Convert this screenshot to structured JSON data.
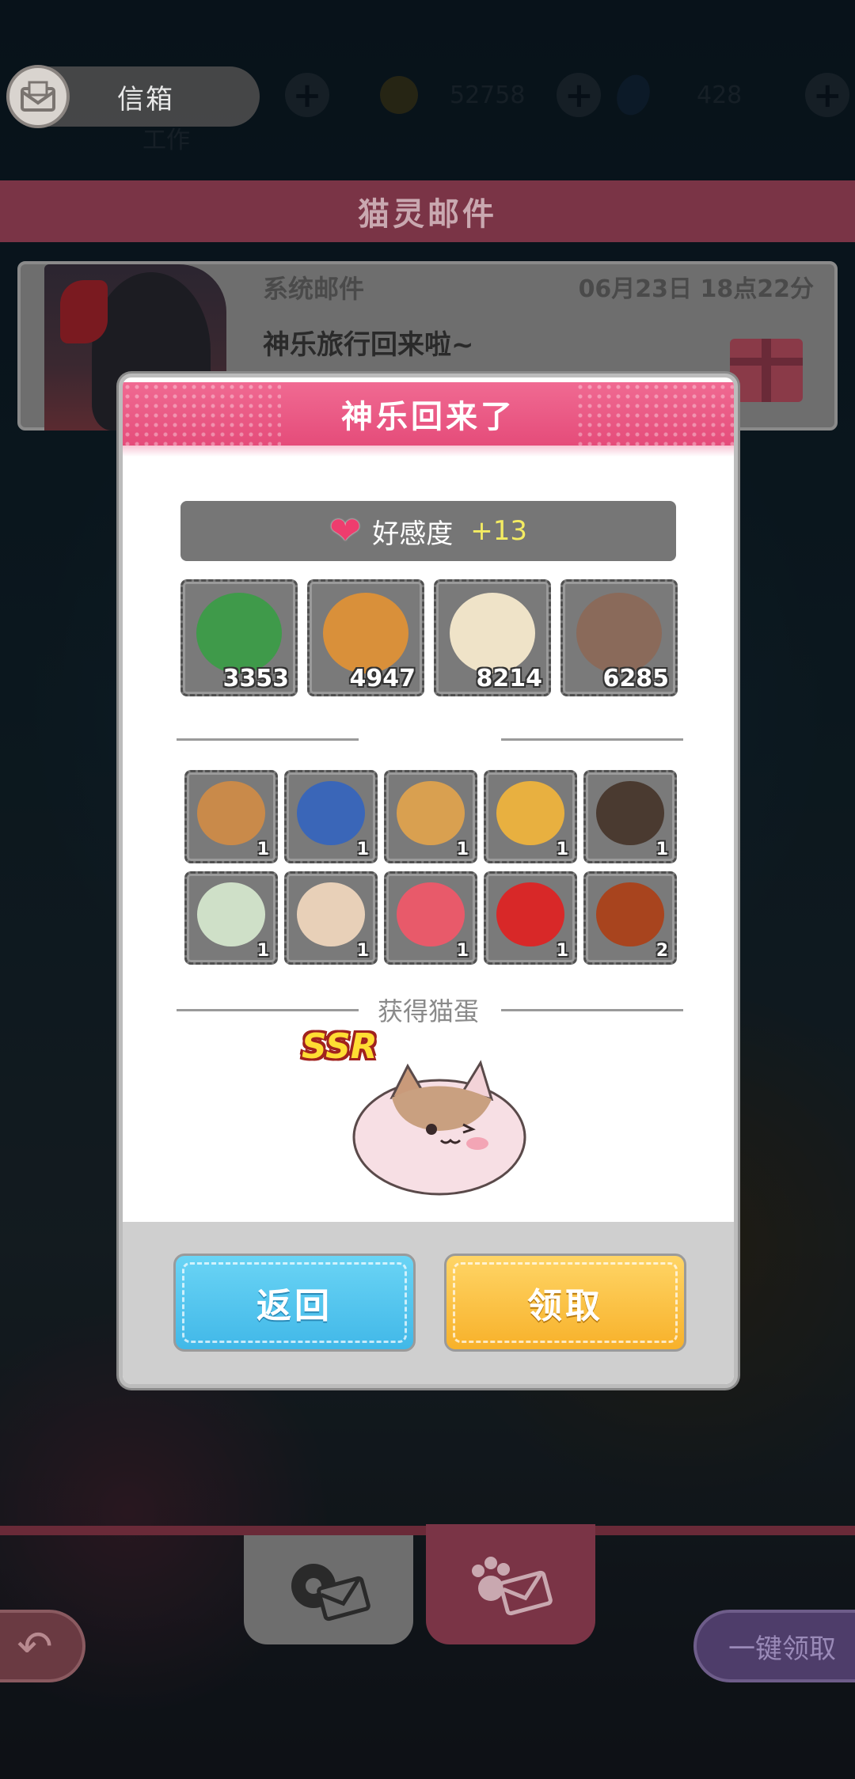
{
  "topbar": {
    "mailbox_label": "信箱",
    "coins": "52758",
    "gems": "428",
    "work_label": "工作"
  },
  "mail_panel": {
    "header_title": "猫灵邮件",
    "mail": {
      "type": "系统邮件",
      "date": "06月23日 18点22分",
      "title": "神乐旅行回来啦~"
    }
  },
  "modal": {
    "title": "神乐回来了",
    "affection": {
      "label": "好感度",
      "value": "+13"
    },
    "resources": [
      {
        "icon": "mint-leaves-icon",
        "count": "3353",
        "color": "#3f9a4a"
      },
      {
        "icon": "cat-food-can-icon",
        "count": "4947",
        "color": "#d9903a"
      },
      {
        "icon": "paw-jar-icon",
        "count": "8214",
        "color": "#efe3c8"
      },
      {
        "icon": "dried-fish-icon",
        "count": "6285",
        "color": "#8a6a5a"
      }
    ],
    "souvenirs": [
      {
        "icon": "rice-bowl-icon",
        "count": "1",
        "color": "#c98a4a"
      },
      {
        "icon": "blue-porcelain-jar-icon",
        "count": "1",
        "color": "#3a66b8"
      },
      {
        "icon": "steamed-buns-icon",
        "count": "1",
        "color": "#d9a050"
      },
      {
        "icon": "mooncake-icon",
        "count": "1",
        "color": "#e8b040"
      },
      {
        "icon": "wine-jar-icon",
        "count": "1",
        "color": "#4a3a30"
      },
      {
        "icon": "puer-tea-cake-icon",
        "count": "1",
        "color": "#cfe0c8"
      },
      {
        "icon": "flower-cake-icon",
        "count": "1",
        "color": "#e8d0b8"
      },
      {
        "icon": "red-ribbon-icon",
        "count": "1",
        "color": "#e85a6a"
      },
      {
        "icon": "opera-mask-icon",
        "count": "1",
        "color": "#d82828"
      },
      {
        "icon": "roast-duck-icon",
        "count": "2",
        "color": "#a8441e"
      }
    ],
    "egg_section_label": "获得猫蛋",
    "egg_rarity": "SSR",
    "buttons": {
      "back": "返回",
      "claim": "领取"
    }
  },
  "bottom": {
    "claim_all": "一键领取"
  }
}
